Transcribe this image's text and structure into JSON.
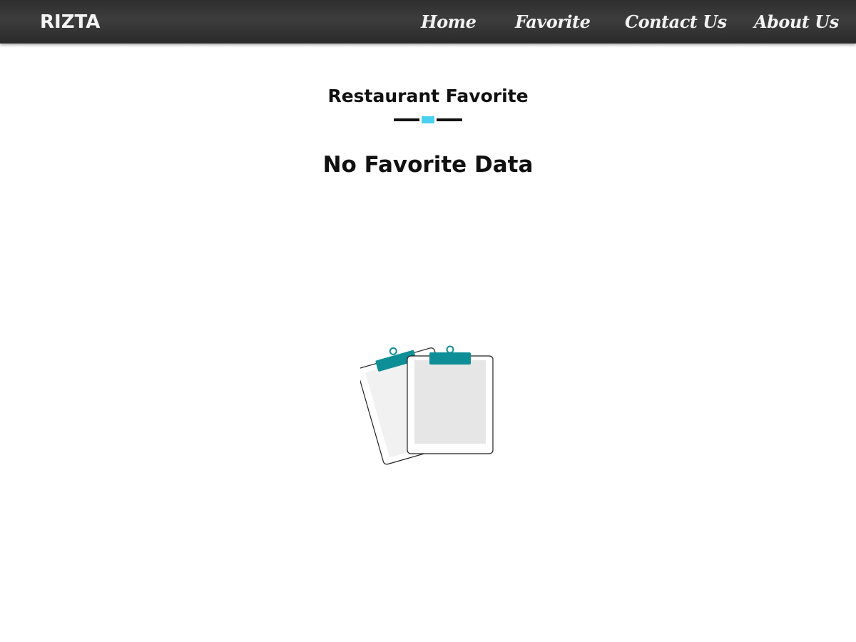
{
  "navbar": {
    "brand": "RIZTA",
    "links": [
      {
        "label": "Home"
      },
      {
        "label": "Favorite"
      },
      {
        "label": "Contact Us"
      },
      {
        "label": "About Us"
      }
    ]
  },
  "main": {
    "section_title": "Restaurant Favorite",
    "empty_message": "No Favorite Data",
    "illustration_icon": "empty-clipboards-icon"
  },
  "colors": {
    "navbar_bg": "#333333",
    "accent": "#4ad0ef",
    "clip": "#0e8e96",
    "text": "#111111"
  }
}
